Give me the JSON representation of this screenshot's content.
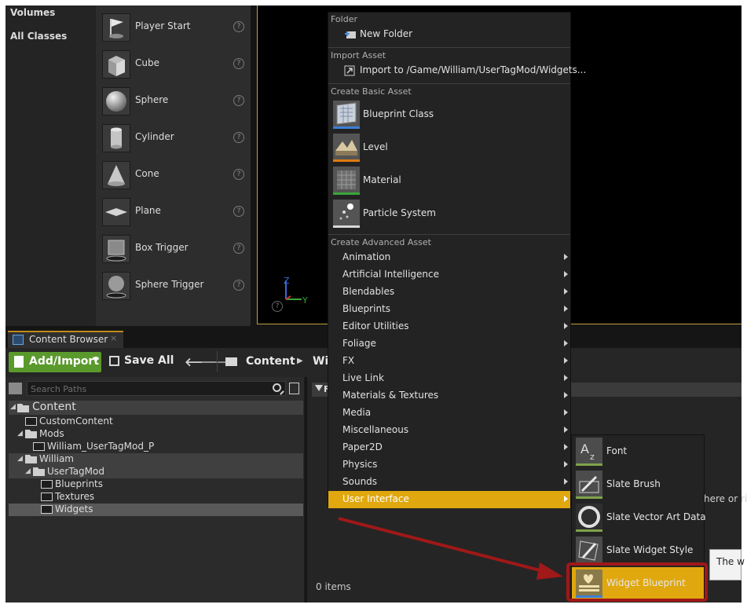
{
  "left_categories": [
    "Volumes",
    "All Classes"
  ],
  "placement_items": [
    {
      "label": "Player Start",
      "icon": "flag-icon"
    },
    {
      "label": "Cube",
      "icon": "cube-icon"
    },
    {
      "label": "Sphere",
      "icon": "sphere-icon"
    },
    {
      "label": "Cylinder",
      "icon": "cylinder-icon"
    },
    {
      "label": "Cone",
      "icon": "cone-icon"
    },
    {
      "label": "Plane",
      "icon": "plane-icon"
    },
    {
      "label": "Box Trigger",
      "icon": "box-trigger-icon"
    },
    {
      "label": "Sphere Trigger",
      "icon": "sphere-trigger-icon"
    }
  ],
  "viewport": {
    "axis_z": "Z",
    "axis_y": "Y",
    "help_icon": "?",
    "accent": "#c2a040"
  },
  "content_browser": {
    "tab_label": "Content Browser",
    "close_glyph": "×",
    "toolbar": {
      "add_import": "Add/Import",
      "save_all": "Save All",
      "back_glyph": "🡐",
      "forward_glyph": "🡒",
      "breadcrumb_root": "Content",
      "breadcrumb_sep": "▶",
      "breadcrumb_next": "Wi"
    },
    "search": {
      "placeholder": "Search Paths"
    },
    "tree": [
      {
        "label": "Content",
        "level": 0,
        "expanded": true
      },
      {
        "label": "CustomContent",
        "level": 1,
        "expanded": false
      },
      {
        "label": "Mods",
        "level": 1,
        "expanded": true
      },
      {
        "label": "William_UserTagMod_P",
        "level": 2,
        "expanded": false
      },
      {
        "label": "William",
        "level": 1,
        "expanded": true
      },
      {
        "label": "UserTagMod",
        "level": 2,
        "expanded": true
      },
      {
        "label": "Blueprints",
        "level": 3,
        "expanded": false
      },
      {
        "label": "Textures",
        "level": 3,
        "expanded": false
      },
      {
        "label": "Widgets",
        "level": 3,
        "expanded": false
      }
    ],
    "filter_label": "F",
    "item_count": "0 items",
    "drop_hint": "here or ri",
    "tooltip": "The w"
  },
  "context_menu": {
    "sections": {
      "folder": "Folder",
      "import": "Import Asset",
      "basic": "Create Basic Asset",
      "advanced": "Create Advanced Asset"
    },
    "new_folder": "New Folder",
    "import_to": "Import to /Game/William/UserTagMod/Widgets...",
    "basic_assets": [
      {
        "label": "Blueprint Class",
        "bar_color": "#3b7fd8"
      },
      {
        "label": "Level",
        "bar_color": "#e07a10"
      },
      {
        "label": "Material",
        "bar_color": "#3aa53a"
      },
      {
        "label": "Particle System",
        "bar_color": "#d8d8d8"
      }
    ],
    "advanced_assets": [
      "Animation",
      "Artificial Intelligence",
      "Blendables",
      "Blueprints",
      "Editor Utilities",
      "Foliage",
      "FX",
      "Live Link",
      "Materials & Textures",
      "Media",
      "Miscellaneous",
      "Paper2D",
      "Physics",
      "Sounds",
      "User Interface"
    ],
    "active_item": "User Interface",
    "active_color": "#e0a80e"
  },
  "submenu": [
    {
      "label": "Font",
      "glyph": "A"
    },
    {
      "label": "Slate Brush",
      "glyph": "✎"
    },
    {
      "label": "Slate Vector Art Data",
      "glyph": "◯"
    },
    {
      "label": "Slate Widget Style",
      "glyph": "✎"
    },
    {
      "label": "Widget Blueprint",
      "glyph": "♥"
    }
  ],
  "highlight_color": "#a01818"
}
